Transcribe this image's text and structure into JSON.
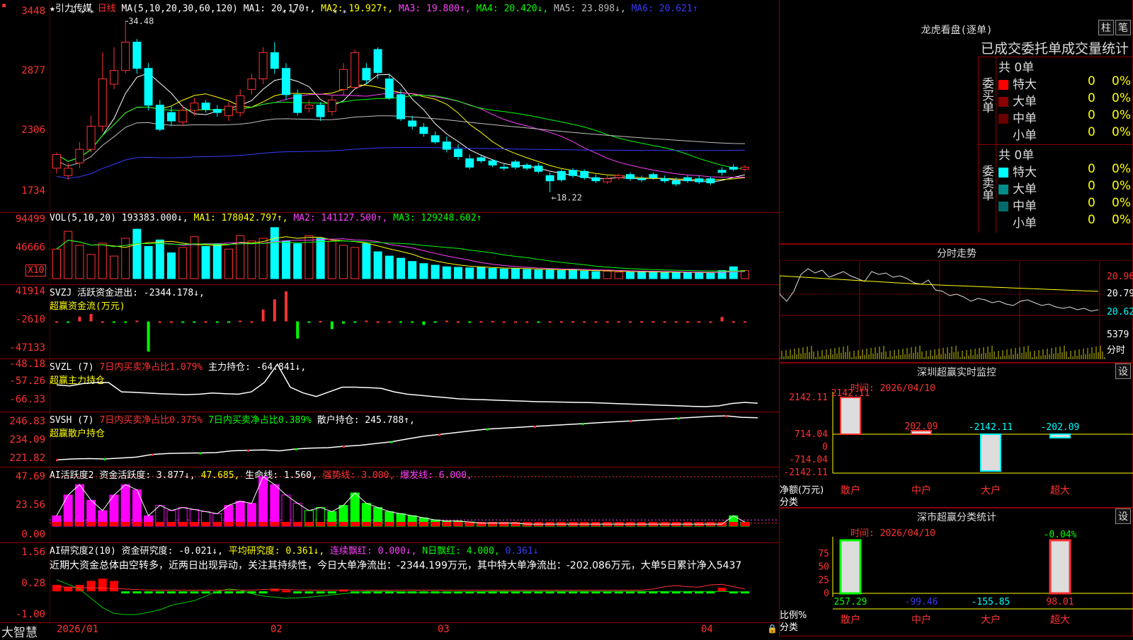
{
  "toolbar": {
    "marker": "▪"
  },
  "kline": {
    "stock_name": "引力传媒",
    "period": "日线",
    "ma_param": "MA(5,10,20,30,60,120)",
    "ma1": "MA1: 20.170↑,",
    "ma2": "MA2: 19.927↑,",
    "ma3": "MA3: 19.800↑,",
    "ma4": "MA4: 20.420↓,",
    "ma5": "MA5: 23.898↓,",
    "ma6": "MA6: 20.621↑",
    "y_labels": [
      "3448",
      "2877",
      "2306",
      "1734"
    ],
    "high_label": "34.48",
    "low_label": "←18.22",
    "stars": [
      "* * *",
      "* *",
      "* *"
    ],
    "colors": {
      "up": "#ff3232",
      "down": "#00ffff",
      "ma1": "#ffffff",
      "ma2": "#ffff00",
      "ma3": "#ff40ff",
      "ma4": "#00ff00",
      "ma5": "#c0c0c0",
      "ma6": "#3a3aff"
    }
  },
  "chart_data": [
    {
      "type": "candlestick",
      "title": "引力传媒 日线",
      "open": [
        20.5,
        19.8,
        21.0,
        22.3,
        24.5,
        28.5,
        29.8,
        32.5,
        30.0,
        26.5,
        25.8,
        24.9,
        26.0,
        26.7,
        26.1,
        25.5,
        25.8,
        28.0,
        29.0,
        31.5,
        30.0,
        27.5,
        26.2,
        26.5,
        25.9,
        28.0,
        28.2,
        30.0,
        31.8,
        29.0,
        27.5,
        25.0,
        24.4,
        23.6,
        23.0,
        22.3,
        21.4,
        21.5,
        21.2,
        20.6,
        21.1,
        20.8,
        20.7,
        19.8,
        20.2,
        20.3,
        20.2,
        19.6,
        19.2,
        19.6,
        19.9,
        19.5,
        19.9,
        19.5,
        19.3,
        19.6,
        19.5,
        19.5,
        20.3,
        20.6,
        20.4
      ],
      "close": [
        21.8,
        20.5,
        22.3,
        24.5,
        29.0,
        29.8,
        32.5,
        30.0,
        26.5,
        24.2,
        25.0,
        26.0,
        26.7,
        26.1,
        25.8,
        26.4,
        27.4,
        29.0,
        31.5,
        30.0,
        27.5,
        25.8,
        26.5,
        25.4,
        27.0,
        29.9,
        31.5,
        28.9,
        29.6,
        27.2,
        25.2,
        24.5,
        23.8,
        23.0,
        22.3,
        21.6,
        20.6,
        21.2,
        20.8,
        20.5,
        20.6,
        20.5,
        20.2,
        19.3,
        19.4,
        19.8,
        19.6,
        19.3,
        19.5,
        19.8,
        19.5,
        19.4,
        19.6,
        19.3,
        19.0,
        19.3,
        19.2,
        19.1,
        20.1,
        20.4,
        20.6
      ],
      "high": [
        22.0,
        21.0,
        23.0,
        25.5,
        31.5,
        32.0,
        34.48,
        32.8,
        30.5,
        27.0,
        26.5,
        26.5,
        27.2,
        27.0,
        26.5,
        26.8,
        28.0,
        29.5,
        32.0,
        32.5,
        30.5,
        28.0,
        27.0,
        26.8,
        27.5,
        30.5,
        31.8,
        30.5,
        32.0,
        29.5,
        28.0,
        25.5,
        24.8,
        24.0,
        23.5,
        22.8,
        21.8,
        21.8,
        21.4,
        20.9,
        21.3,
        21.0,
        21.0,
        20.1,
        20.4,
        20.5,
        20.4,
        19.9,
        19.8,
        20.0,
        20.1,
        19.8,
        20.1,
        19.8,
        19.6,
        19.8,
        19.8,
        19.7,
        20.6,
        20.9,
        20.8
      ],
      "low": [
        20.0,
        19.4,
        20.5,
        22.0,
        24.0,
        28.0,
        29.5,
        29.5,
        26.0,
        24.0,
        24.5,
        24.5,
        25.5,
        25.8,
        25.4,
        25.0,
        25.4,
        27.5,
        28.5,
        29.5,
        27.0,
        25.5,
        25.8,
        25.0,
        25.5,
        27.5,
        28.0,
        28.5,
        29.0,
        27.0,
        25.0,
        24.2,
        23.5,
        22.8,
        22.0,
        21.3,
        20.4,
        21.0,
        20.6,
        20.3,
        20.4,
        20.3,
        20.0,
        18.22,
        19.2,
        19.6,
        19.4,
        19.1,
        19.0,
        19.4,
        19.3,
        19.2,
        19.4,
        19.1,
        18.8,
        19.1,
        19.0,
        18.9,
        19.8,
        20.2,
        20.2
      ],
      "ylim": [
        18.0,
        35.5
      ]
    },
    {
      "type": "bar",
      "title": "VOL(5,10,20)",
      "values": [
        55,
        88,
        62,
        45,
        66,
        42,
        75,
        92,
        60,
        72,
        48,
        58,
        78,
        60,
        65,
        55,
        80,
        70,
        75,
        95,
        70,
        65,
        80,
        75,
        70,
        62,
        58,
        65,
        50,
        42,
        38,
        32,
        28,
        25,
        22,
        21,
        20,
        21,
        19,
        18,
        19,
        17,
        16,
        16,
        15,
        17,
        14,
        13,
        14,
        12,
        12,
        13,
        12,
        11,
        12,
        11,
        11,
        10,
        15,
        22,
        15
      ],
      "ylim": [
        0,
        100
      ]
    },
    {
      "type": "bar",
      "title": "SVZJ 超赢资金流(万元)",
      "values": [
        -2600,
        -4200,
        4500,
        8500,
        -2600,
        -2800,
        -3200,
        -1500,
        -47133,
        -2600,
        -2600,
        -3000,
        -3100,
        -2500,
        -2800,
        -2800,
        -1500,
        -2600,
        15000,
        30000,
        41914,
        -28000,
        -4000,
        -2000,
        -14000,
        -6000,
        -3000,
        -1500,
        -2600,
        -2600,
        -4000,
        -3200,
        -7800,
        -3500,
        -1500,
        -2600,
        -2800,
        -2300,
        -2000,
        -2600,
        -2600,
        -2600,
        -2800,
        -2500,
        -2500,
        -2500,
        -2500,
        -2500,
        -2500,
        -2500,
        -2500,
        -2500,
        -2500,
        -2500,
        -2500,
        -2500,
        -2500,
        -2500,
        4000,
        -2500,
        -2500
      ],
      "ylim": [
        -47133,
        41914
      ]
    },
    {
      "type": "line",
      "title": "SVZL 超赢主力持仓",
      "values": [
        -57.0,
        -57.5,
        -56.5,
        -56.0,
        -56.0,
        -60.0,
        -60.2,
        -60.5,
        -60.8,
        -61.0,
        -61.2,
        -61.0,
        -60.5,
        -60.8,
        -61.0,
        -60.0,
        -56.0,
        -48.18,
        -58.0,
        -60.5,
        -62.0,
        -60.0,
        -58.0,
        -58.0,
        -58.2,
        -58.5,
        -60.0,
        -61.0,
        -61.5,
        -62.0,
        -62.5,
        -63.0,
        -63.2,
        -63.4,
        -63.6,
        -63.8,
        -64.0,
        -64.2,
        -64.3,
        -64.4,
        -64.5,
        -64.6,
        -64.8,
        -65.0,
        -65.2,
        -65.4,
        -65.6,
        -65.8,
        -66.0,
        -66.2,
        -66.33,
        -66.0,
        -65.0,
        -64.5,
        -64.84
      ],
      "ylim": [
        -66.33,
        -48.18
      ]
    },
    {
      "type": "line",
      "title": "SVSH 超赢散户持仓",
      "values": [
        222.5,
        223.0,
        223.2,
        223.0,
        223.5,
        224.0,
        225.5,
        226.0,
        226.2,
        226.3,
        226.5,
        227.5,
        227.8,
        228.0,
        227.5,
        228.5,
        229.0,
        229.2,
        230.0,
        230.5,
        231.5,
        232.5,
        234.0,
        235.5,
        236.5,
        237.5,
        238.5,
        239.5,
        240.0,
        240.5,
        241.0,
        241.5,
        242.0,
        242.5,
        243.0,
        243.5,
        244.0,
        244.5,
        245.0,
        245.5,
        246.0,
        246.5,
        246.83,
        246.0,
        245.788
      ],
      "ylim": [
        221.82,
        246.83
      ]
    },
    {
      "type": "bar",
      "title": "AI活跃度2",
      "values": [
        10,
        30,
        40,
        25,
        15,
        30,
        40,
        35,
        10,
        20,
        15,
        18,
        16,
        14,
        12,
        20,
        24,
        22,
        47.685,
        40,
        30,
        22,
        15,
        18,
        14,
        20,
        32,
        22,
        18,
        14,
        12,
        10,
        8,
        6,
        5,
        5,
        4,
        3,
        3,
        3,
        3,
        2,
        2,
        2,
        2,
        2,
        2,
        2,
        2,
        2,
        2,
        2,
        2,
        2,
        2,
        2,
        2,
        2,
        2,
        10,
        3.877
      ],
      "ylim": [
        0,
        47.69
      ]
    },
    {
      "type": "bar",
      "title": "AI研究度2(10)",
      "values": [
        0.28,
        0.2,
        0.28,
        0.45,
        0.55,
        0.45,
        -0.05,
        -0.05,
        -0.05,
        -0.05,
        -0.05,
        -0.05,
        -0.05,
        -0.05,
        -0.05,
        -0.05,
        -0.05,
        -0.05,
        -0.05,
        0.1,
        0.05,
        -0.05,
        -0.05,
        -0.05,
        -0.05,
        0.08,
        -0.05,
        -0.05,
        -0.05,
        -0.05,
        -0.05,
        -0.05,
        -0.05,
        -0.05,
        -0.05,
        -0.05,
        -0.05,
        -0.05,
        -0.05,
        -0.05,
        -0.05,
        -0.05,
        -0.05,
        -0.05,
        -0.05,
        -0.05,
        -0.05,
        -0.05,
        -0.05,
        -0.05,
        -0.05,
        -0.05,
        -0.05,
        -0.05,
        -0.05,
        -0.05,
        -0.05,
        -0.05,
        0.15,
        -0.021,
        -0.021
      ],
      "ylim": [
        -1.0,
        1.56
      ]
    }
  ],
  "vol": {
    "param": "VOL(5,10,20)",
    "value": "193383.000↓,",
    "ma1": "MA1: 178042.797↑,",
    "ma2": "MA2: 141127.500↑,",
    "ma3": "MA3: 129248.602↑",
    "y_labels": [
      "94499",
      "46666"
    ],
    "unit": "X10"
  },
  "svzj": {
    "name": "SVZJ",
    "text": "活跃资金进出: -2344.178↓,",
    "subtitle": "超赢资金流(万元)",
    "y_labels": [
      "41914",
      "-2610",
      "-47133"
    ]
  },
  "svzl": {
    "name": "SVZL (7)",
    "ratio": "7日内买卖净占比1.079%",
    "hold": "主力持仓: -64.841↓,",
    "subtitle": "超赢主力持仓",
    "y_labels": [
      "-48.18",
      "-57.26",
      "-66.33"
    ]
  },
  "svsh": {
    "name": "SVSH (7)",
    "ratio1": "7日内买卖净占比0.375%",
    "ratio2": "7日内买卖净占比0.389%",
    "hold": "散户持仓: 245.788↑,",
    "subtitle": "超赢散户持仓",
    "y_labels": [
      "246.83",
      "234.09",
      "221.82"
    ]
  },
  "ai1": {
    "name": "AI活跃度2",
    "a": "资金活跃度: 3.877↓,",
    "b": "47.685,",
    "c": "生命线: 1.560,",
    "d": "强势线: 3.000,",
    "e": "爆发线: 6.000,",
    "y_labels": [
      "47.69",
      "23.56",
      "0.00"
    ]
  },
  "ai2": {
    "name": "AI研究度2(10)",
    "a": "资金研究度: -0.021↓,",
    "b": "平均研究度: 0.361↓,",
    "c": "连续飘红: 0.000↓,",
    "d": "N日飘红: 4.000,",
    "e": "0.361↓",
    "note": "近期大资金总体由空转多，近两日出现异动，关注其持续性，今日大单净流出：-2344.199万元，其中特大单净流出：-202.086万元，大单5日累计净入5437",
    "y_labels": [
      "1.56",
      "0.28",
      "-1.00"
    ]
  },
  "xaxis": {
    "brand": "大智慧",
    "labels": [
      "2026/01",
      "02",
      "03",
      "04"
    ]
  },
  "right": {
    "lhb_title": "龙虎看盘(逐单)",
    "btn_bar": "柱",
    "btn_tick": "笔",
    "order_header": "已成交委托单成交量统计",
    "buy_label": "委买单",
    "sell_label": "委卖单",
    "buy_total": "共 0单",
    "sell_total": "共 0单",
    "rows": [
      {
        "name": "特大",
        "qty": "0",
        "pct": "0%"
      },
      {
        "name": "大单",
        "qty": "0",
        "pct": "0%"
      },
      {
        "name": "中单",
        "qty": "0",
        "pct": "0%"
      },
      {
        "name": "小单",
        "qty": "0",
        "pct": "0%"
      }
    ],
    "buy_colors": [
      "#ff0000",
      "#8b0000",
      "#6a0000",
      "#000000"
    ],
    "sell_colors": [
      "#00ffff",
      "#008b8b",
      "#006a6a",
      "#000000"
    ],
    "intraday_title": "分时走势",
    "intraday_y": [
      "20.96",
      "20.79",
      "20.62"
    ],
    "intraday_vol": "5379",
    "intraday_unit": "分时",
    "monitor_title": "深圳超赢实时监控",
    "btn_set": "设",
    "monitor_time": "时间: 2026/04/10",
    "monitor_y": [
      "2142.11",
      "714.04",
      "0",
      "-714.04",
      "-2142.11"
    ],
    "monitor_values": [
      "2142.11",
      "202.09",
      "-2142.11",
      "-202.09"
    ],
    "monitor_ylabel": "净额(万元)",
    "monitor_xlabel": "分类",
    "categories": [
      "散户",
      "中户",
      "大户",
      "超大"
    ],
    "stat_title": "深市超赢分类统计",
    "stat_time": "时间: 2026/04/10",
    "stat_y": [
      "75",
      "50",
      "25",
      "0"
    ],
    "stat_top": "-0.04%",
    "stat_values": [
      "257.29",
      "-99.46",
      "-155.85",
      "98.01"
    ],
    "stat_ylabel": "比例%",
    "stat_xlabel": "分类"
  }
}
